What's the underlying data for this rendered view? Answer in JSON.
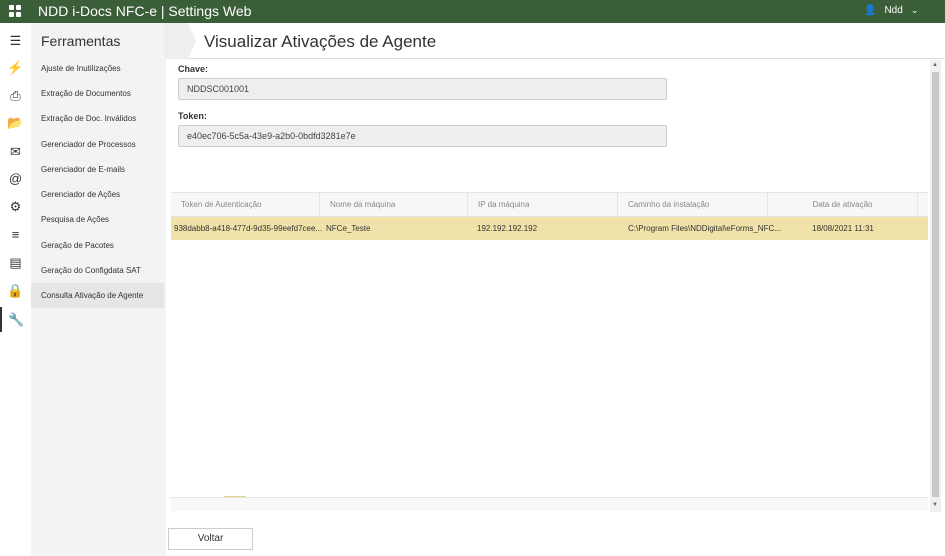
{
  "header": {
    "title": "NDD i-Docs NFC-e | Settings Web",
    "user": "Ndd",
    "brand_color": "#3a5e38"
  },
  "rail": {
    "icons": [
      "menu-icon",
      "plug-icon",
      "printer-icon",
      "folder-open-icon",
      "envelope-icon",
      "at-icon",
      "gear-icon",
      "sliders-icon",
      "server-icon",
      "lock-icon",
      "wrench-icon"
    ]
  },
  "sidebar": {
    "title": "Ferramentas",
    "items": [
      {
        "label": "Ajuste de Inutilizações"
      },
      {
        "label": "Extração de Documentos"
      },
      {
        "label": "Extração de Doc. Inválidos"
      },
      {
        "label": "Gerenciador de Processos"
      },
      {
        "label": "Gerenciador de E-mails"
      },
      {
        "label": "Gerenciador de Ações"
      },
      {
        "label": "Pesquisa de Ações"
      },
      {
        "label": "Geração de Pacotes"
      },
      {
        "label": "Geração do Configdata SAT"
      },
      {
        "label": "Consulta Ativação de Agente",
        "selected": true
      }
    ]
  },
  "page": {
    "title": "Visualizar Ativações de Agente",
    "chave_label": "Chave:",
    "chave_value": "NDDSC001001",
    "token_label": "Token:",
    "token_value": "e40ec706-5c5a-43e9-a2b0-0bdfd3281e7e"
  },
  "grid": {
    "columns": [
      "Token de Autenticação",
      "Nome da máquina",
      "IP da máquina",
      "Caminho da instalação",
      "Data de ativação"
    ],
    "rows": [
      {
        "token": "938dabb8-a418-477d-9d35-99eefd7cee...",
        "machine": "NFCe_Teste",
        "ip": "192.192.192.192",
        "path": "C:\\Program Files\\NDDigital\\eForms_NFC...",
        "date": "18/08/2021 11:31"
      }
    ],
    "selected_row_color": "#f0e2a8"
  },
  "footer": {
    "back_label": "Voltar"
  }
}
